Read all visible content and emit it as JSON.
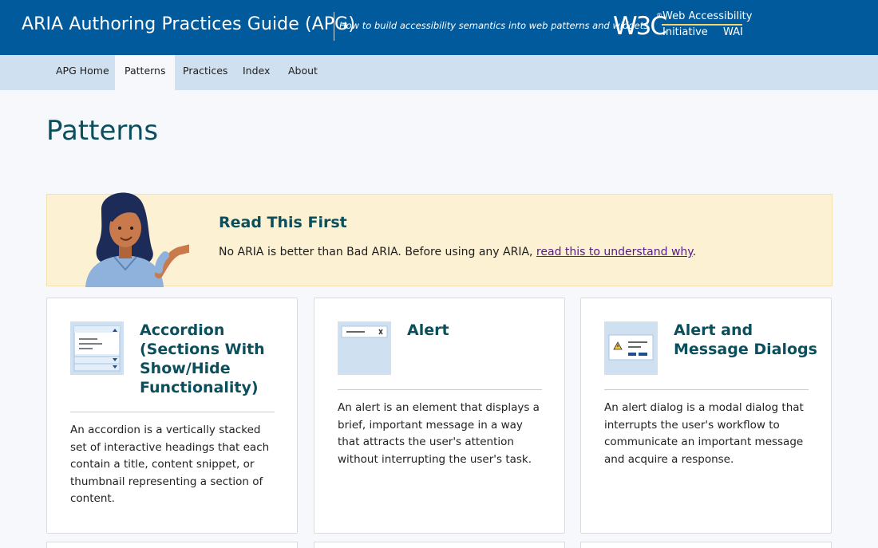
{
  "header": {
    "site_title": "ARIA Authoring Practices Guide (APG)",
    "tagline": "How to build accessibility semantics into web patterns and widgets",
    "logo_letters": "W3C",
    "wai_line1": "Web Accessibility",
    "wai_line2": "Initiative",
    "wai_abbr": "WAI",
    "bg_color": "#005a9c"
  },
  "nav": {
    "items": [
      {
        "label": "APG Home"
      },
      {
        "label": "Patterns",
        "active": true
      },
      {
        "label": "Practices"
      },
      {
        "label": "Index"
      },
      {
        "label": "About"
      }
    ]
  },
  "page": {
    "title": "Patterns"
  },
  "notice": {
    "title": "Read This First",
    "text": "No ARIA is better than Bad ARIA. Before using any ARIA, ",
    "link_text": "read this to understand why",
    "text_end": "."
  },
  "cards": [
    {
      "title_lines": [
        "Accordion",
        "(Sections With",
        "Show/Hide",
        "Functionality)"
      ],
      "icon": "accordion-icon",
      "desc_lines": [
        "An accordion is a vertically stacked",
        "set of interactive headings that each",
        "contain a title, content snippet, or",
        "thumbnail representing a section of",
        "content."
      ]
    },
    {
      "title_lines": [
        "Alert"
      ],
      "icon": "alert-icon",
      "desc_lines": [
        "An alert is an element that displays a",
        "brief, important message in a way",
        "that attracts the user's attention",
        "without interrupting the user's task."
      ]
    },
    {
      "title_lines": [
        "Alert and",
        "Message Dialogs"
      ],
      "icon": "alert-dialog-icon",
      "desc_lines": [
        "An alert dialog is a modal dialog that",
        "interrupts the user's workflow to",
        "communicate an important message",
        "and acquire a response."
      ]
    }
  ]
}
